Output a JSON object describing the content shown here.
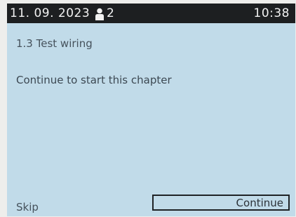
{
  "status_bar": {
    "date": "11. 09. 2023",
    "user_icon": "user-icon",
    "user_count": "2",
    "time": "10:38"
  },
  "content": {
    "chapter_title": "1.3 Test wiring",
    "instruction": "Continue to start this chapter"
  },
  "footer": {
    "skip_label": "Skip",
    "continue_label": "Continue"
  },
  "colors": {
    "screen_background": "#c1dbe9",
    "status_bar_background": "#1d1f21",
    "status_bar_text": "#f2f2f2"
  }
}
